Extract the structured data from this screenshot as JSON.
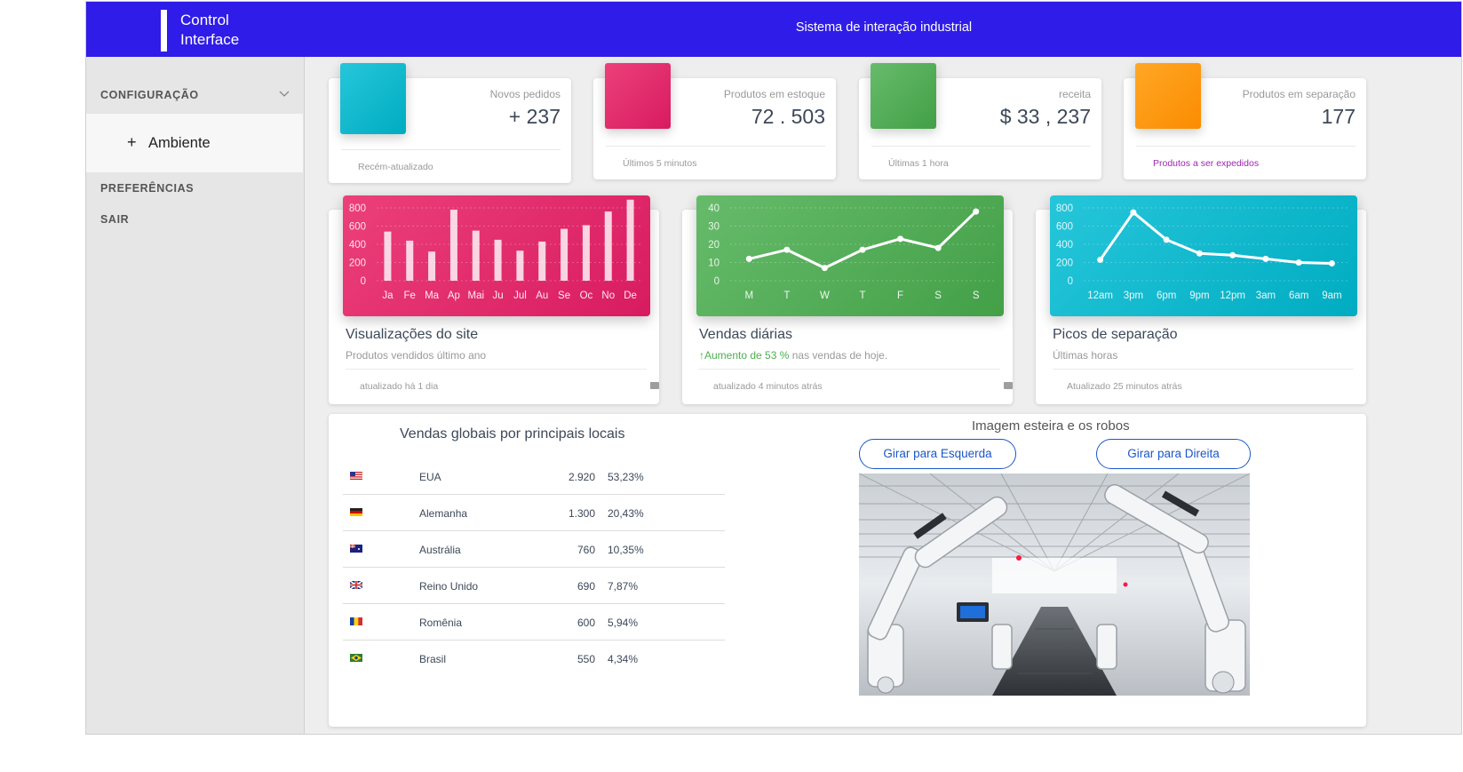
{
  "brand": {
    "title_line1": "Control",
    "title_line2": "Interface"
  },
  "header": {
    "title": "Sistema de interação industrial"
  },
  "sidebar": {
    "items": [
      {
        "label": "CONFIGURAÇÃO",
        "icon": "chevron-down-icon"
      },
      {
        "label": "Ambiente",
        "icon": "plus-icon"
      },
      {
        "label": "PREFERÊNCIAS"
      },
      {
        "label": "SAIR"
      }
    ]
  },
  "stats": [
    {
      "category": "Novos pedidos",
      "value": "+ 237",
      "footer": "Recém-atualizado",
      "color": "#1ec0d8"
    },
    {
      "category": "Produtos em estoque",
      "value": "72 . 503",
      "footer": "Últimos 5 minutos",
      "color": "#e8336a"
    },
    {
      "category": "receita",
      "value": "$ 33 , 237",
      "footer": "Últimas 1 hora",
      "color": "#57b55b"
    },
    {
      "category": "Produtos em separação",
      "value": "177",
      "footer": "Produtos a ser expedidos",
      "footer_color": "#9c27b0",
      "color": "#ff9a1a"
    }
  ],
  "charts": [
    {
      "title": "Visualizações do site",
      "category": "Produtos vendidos último ano",
      "footer": "atualizado há 1 dia"
    },
    {
      "title": "Vendas diárias",
      "category_up": "Aumento de 53 %",
      "category_rest": " nas vendas de hoje.",
      "footer": "atualizado 4 minutos atrás"
    },
    {
      "title": "Picos de separação",
      "category": "Últimas horas",
      "footer": "Atualizado 25 minutos atrás"
    }
  ],
  "chart_data": [
    {
      "type": "bar",
      "categories": [
        "Ja",
        "Fe",
        "Ma",
        "Ap",
        "Mai",
        "Ju",
        "Jul",
        "Au",
        "Se",
        "Oc",
        "No",
        "De"
      ],
      "values": [
        540,
        440,
        320,
        780,
        550,
        450,
        330,
        430,
        570,
        610,
        760,
        890
      ],
      "yticks": [
        0,
        200,
        400,
        600,
        800
      ],
      "ylim": [
        0,
        800
      ],
      "color": "#e91e63"
    },
    {
      "type": "line",
      "categories": [
        "M",
        "T",
        "W",
        "T",
        "F",
        "S",
        "S"
      ],
      "values": [
        12,
        17,
        7,
        17,
        23,
        18,
        38
      ],
      "yticks": [
        0,
        10,
        20,
        30,
        40
      ],
      "ylim": [
        0,
        40
      ],
      "color": "#4caf50"
    },
    {
      "type": "line",
      "categories": [
        "12am",
        "3pm",
        "6pm",
        "9pm",
        "12pm",
        "3am",
        "6am",
        "9am"
      ],
      "values": [
        230,
        750,
        450,
        300,
        280,
        240,
        200,
        190
      ],
      "yticks": [
        0,
        200,
        400,
        600,
        800
      ],
      "ylim": [
        0,
        800
      ],
      "color": "#00bcd4"
    }
  ],
  "countries": {
    "title": "Vendas globais por principais locais",
    "rows": [
      {
        "flag": "usa-flag-icon",
        "name": "EUA",
        "count": "2.920",
        "pct": "53,23%"
      },
      {
        "flag": "germany-flag-icon",
        "name": "Alemanha",
        "count": "1.300",
        "pct": "20,43%"
      },
      {
        "flag": "australia-flag-icon",
        "name": "Austrália",
        "count": "760",
        "pct": "10,35%"
      },
      {
        "flag": "uk-flag-icon",
        "name": "Reino Unido",
        "count": "690",
        "pct": "7,87%"
      },
      {
        "flag": "romania-flag-icon",
        "name": "Romênia",
        "count": "600",
        "pct": "5,94%"
      },
      {
        "flag": "brazil-flag-icon",
        "name": "Brasil",
        "count": "550",
        "pct": "4,34%"
      }
    ]
  },
  "robots": {
    "title": "Imagem esteira e os robos",
    "left_button": "Girar para Esquerda",
    "right_button": "Girar para Direita"
  }
}
